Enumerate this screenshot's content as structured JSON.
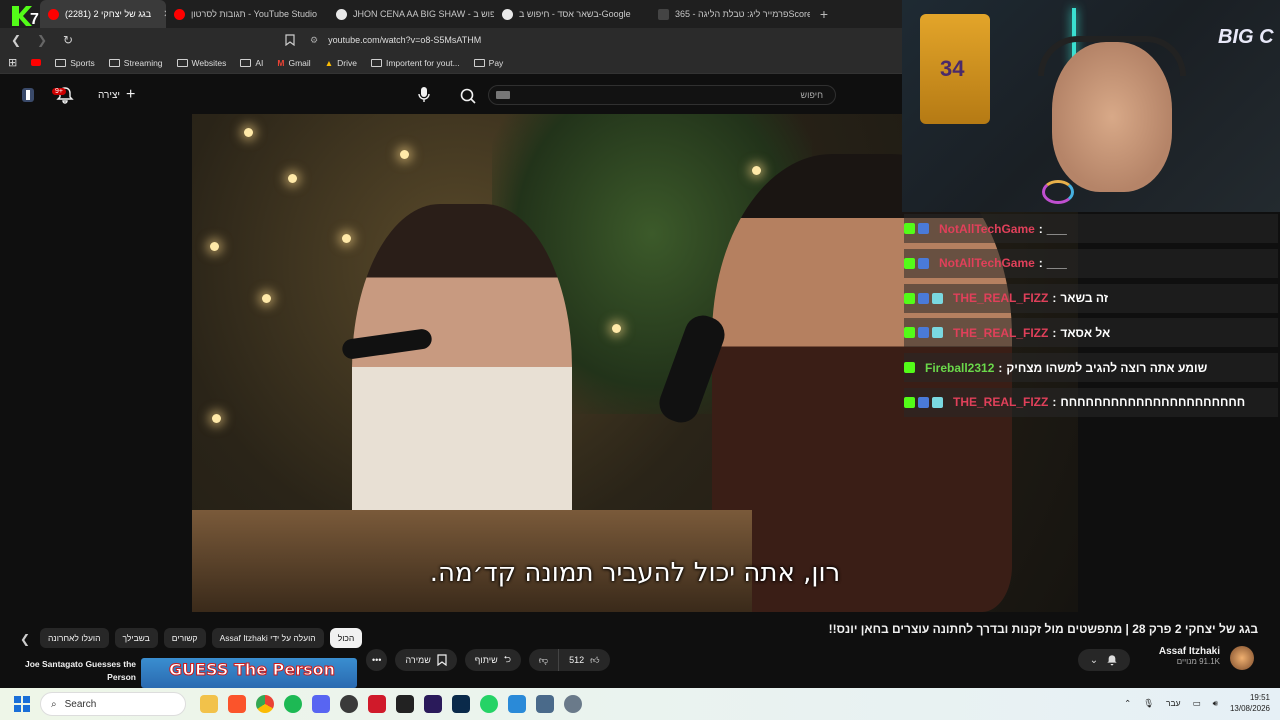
{
  "browser": {
    "tabs": [
      {
        "label": "בגג של יצחקי 2 (2281)",
        "active": true,
        "color": "#ff0000"
      },
      {
        "label": "תגובות לסרטון - YouTube Studio",
        "active": false,
        "color": "#ff0000"
      },
      {
        "label": "JHON CENA AA BIG SHAW - חיפוש ב",
        "active": false,
        "color": "#4285f4"
      },
      {
        "label": "בשאר אסד - חיפוש ב-Google",
        "active": false,
        "color": "#4285f4"
      },
      {
        "label": "פרמייר ליג: טבלת הליגה - 365Scores",
        "active": false,
        "color": "#222222"
      }
    ],
    "tab_count": "7",
    "new_tab": "+",
    "url": "youtube.com/watch?v=o8-S5MsATHM",
    "bookmarks": [
      "Sports",
      "Streaming",
      "Websites",
      "AI",
      "Gmail",
      "Drive",
      "Importent for yout...",
      "Pay"
    ]
  },
  "youtube": {
    "search_placeholder": "חיפוש",
    "create_label": "יצירה",
    "notif_count": "9+",
    "subtitle": "רון, אתה יכול להעביר תמונה קד׳מה.",
    "video_title": "בגג של יצחקי 2 פרק 28 | מתפשטים מול זקנות ובדרך לחתונה עוצרים בחאן יונס!!",
    "channel_name": "Assaf Itzhaki",
    "channel_subs": "91.1K מנויים",
    "like_count": "512",
    "share_label": "שיתוף",
    "save_label": "שמירה",
    "chips": [
      "הכול",
      "הועלה על ידי Assaf Itzhaki",
      "קשורים",
      "בשבילך",
      "הועלו לאחרונה"
    ],
    "reco_title": "Joe Santagato Guesses the Person",
    "reco_thumb_text": "GUESS The Person"
  },
  "stream": {
    "logo": "BIG C",
    "jersey_number": "34",
    "chat": [
      {
        "user": "NotAllTechGame",
        "message": "___",
        "color": "#e0405a",
        "extra_badges": false
      },
      {
        "user": "NotAllTechGame",
        "message": "___",
        "color": "#e0405a",
        "extra_badges": false
      },
      {
        "user": "THE_REAL_FIZZ",
        "message": "זה בשאר",
        "color": "#e0405a",
        "extra_badges": true
      },
      {
        "user": "THE_REAL_FIZZ",
        "message": "אל אסאד",
        "color": "#e0405a",
        "extra_badges": true
      },
      {
        "user": "Fireball2312",
        "message": "שומע אתה רוצה להגיב למשהו מצחיק",
        "color": "#6ad84a",
        "extra_badges": false
      },
      {
        "user": "THE_REAL_FIZZ",
        "message": "חחחחחחחחחחחחחחחחחחחחחח",
        "color": "#e0405a",
        "extra_badges": true
      }
    ]
  },
  "taskbar": {
    "search_label": "Search",
    "lang": "עבר",
    "time": "19:51",
    "date": "13/08/2026"
  }
}
